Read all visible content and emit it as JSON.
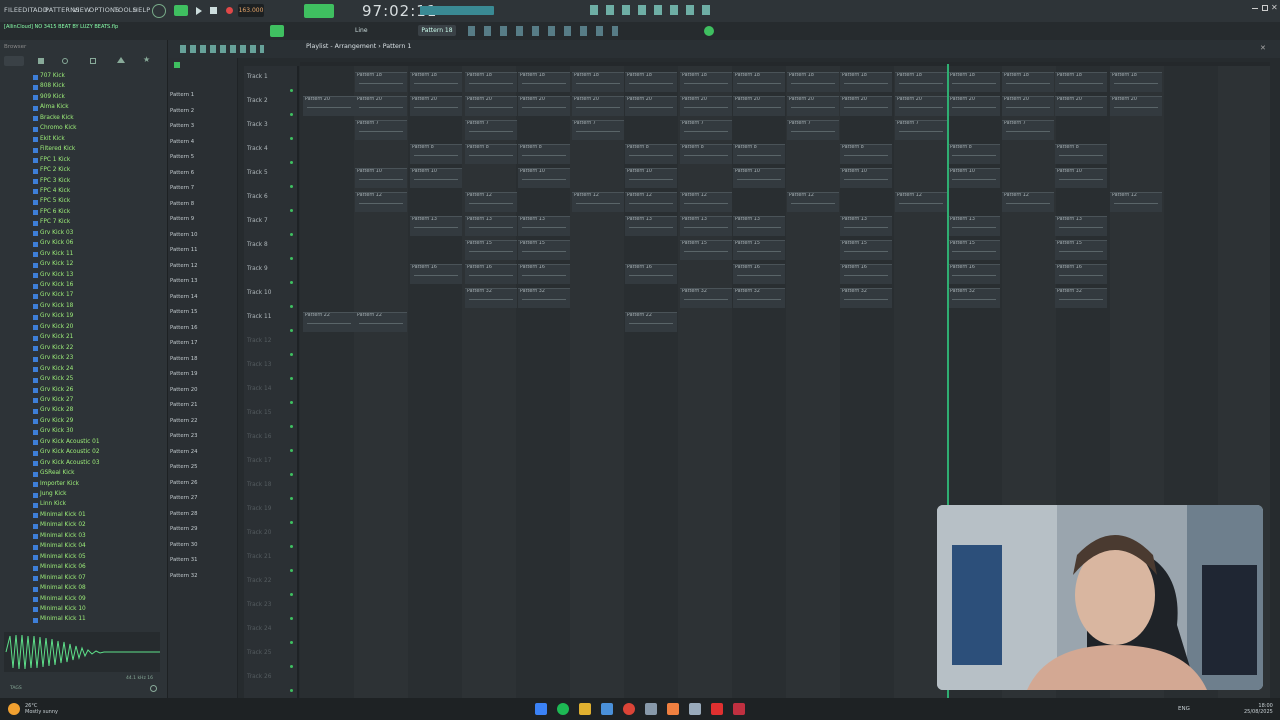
{
  "menu": {
    "items": [
      "FILE",
      "EDIT",
      "ADD",
      "PATTERNS",
      "VIEW",
      "OPTIONS",
      "TOOLS",
      "HELP"
    ]
  },
  "hint": "[AllinCloud] NO 3415 BEAT BY LUZY BEATS.flp",
  "transport": {
    "tempo": "163.000",
    "time": "97:02:11"
  },
  "pattern_selector": "Pattern 18",
  "snap": "Line",
  "playlist_title": "Playlist - Arrangement › Pattern 1",
  "browser": {
    "title": "Browser",
    "items": [
      "707 Kick",
      "808 Kick",
      "909 Kick",
      "Alma Kick",
      "Bracke Kick",
      "Chromo Kick",
      "Ekit Kick",
      "Filtered Kick",
      "FPC 1 Kick",
      "FPC 2 Kick",
      "FPC 3 Kick",
      "FPC 4 Kick",
      "FPC 5 Kick",
      "FPC 6 Kick",
      "FPC 7 Kick",
      "Grv Kick 03",
      "Grv Kick 06",
      "Grv Kick 11",
      "Grv Kick 12",
      "Grv Kick 13",
      "Grv Kick 16",
      "Grv Kick 17",
      "Grv Kick 18",
      "Grv Kick 19",
      "Grv Kick 20",
      "Grv Kick 21",
      "Grv Kick 22",
      "Grv Kick 23",
      "Grv Kick 24",
      "Grv Kick 25",
      "Grv Kick 26",
      "Grv Kick 27",
      "Grv Kick 28",
      "Grv Kick 29",
      "Grv Kick 30",
      "Grv Kick Acoustic 01",
      "Grv Kick Acoustic 02",
      "Grv Kick Acoustic 03",
      "GSReal Kick",
      "Importer Kick",
      "Jung Kick",
      "Linn Kick",
      "Minimal Kick 01",
      "Minimal Kick 02",
      "Minimal Kick 03",
      "Minimal Kick 04",
      "Minimal Kick 05",
      "Minimal Kick 06",
      "Minimal Kick 07",
      "Minimal Kick 08",
      "Minimal Kick 09",
      "Minimal Kick 10",
      "Minimal Kick 11"
    ],
    "sample_info": "44.1 kHz 16",
    "tags_label": "TAGS"
  },
  "patterns": [
    "Pattern 1",
    "Pattern 2",
    "Pattern 3",
    "Pattern 4",
    "Pattern 5",
    "Pattern 6",
    "Pattern 7",
    "Pattern 8",
    "Pattern 9",
    "Pattern 10",
    "Pattern 11",
    "Pattern 12",
    "Pattern 13",
    "Pattern 14",
    "Pattern 15",
    "Pattern 16",
    "Pattern 17",
    "Pattern 18",
    "Pattern 19",
    "Pattern 20",
    "Pattern 21",
    "Pattern 22",
    "Pattern 23",
    "Pattern 24",
    "Pattern 25",
    "Pattern 26",
    "Pattern 27",
    "Pattern 28",
    "Pattern 29",
    "Pattern 30",
    "Pattern 31",
    "Pattern 32"
  ],
  "tracks": [
    "Track 1",
    "Track 2",
    "Track 3",
    "Track 4",
    "Track 5",
    "Track 6",
    "Track 7",
    "Track 8",
    "Track 9",
    "Track 10",
    "Track 11",
    "Track 12",
    "Track 13",
    "Track 14",
    "Track 15",
    "Track 16",
    "Track 17",
    "Track 18",
    "Track 19",
    "Track 20",
    "Track 21",
    "Track 22",
    "Track 23",
    "Track 24",
    "Track 25",
    "Track 26"
  ],
  "clip_rows": [
    {
      "label": "Pattern 18",
      "starts": [
        355,
        410,
        465,
        518,
        572,
        625,
        680,
        733,
        787,
        840,
        895,
        948,
        1002,
        1055,
        1110
      ]
    },
    {
      "label": "Pattern 20",
      "starts": [
        303,
        355,
        410,
        465,
        518,
        572,
        625,
        680,
        733,
        787,
        840,
        895,
        948,
        1002,
        1055,
        1110
      ]
    },
    {
      "label": "Pattern 7",
      "starts": [
        355,
        465,
        572,
        680,
        787,
        895,
        1002
      ]
    },
    {
      "label": "Pattern 8",
      "starts": [
        410,
        465,
        518,
        625,
        680,
        733,
        840,
        948,
        1055
      ]
    },
    {
      "label": "Pattern 10",
      "starts": [
        355,
        410,
        518,
        625,
        733,
        840,
        948,
        1055
      ]
    },
    {
      "label": "Pattern 12",
      "starts": [
        355,
        465,
        572,
        625,
        680,
        787,
        895,
        1002,
        1110
      ]
    },
    {
      "label": "Pattern 13",
      "starts": [
        410,
        465,
        518,
        625,
        680,
        733,
        840,
        948,
        1055
      ]
    },
    {
      "label": "Pattern 15",
      "starts": [
        465,
        518,
        680,
        733,
        840,
        948,
        1055
      ]
    },
    {
      "label": "Pattern 16",
      "starts": [
        410,
        465,
        518,
        625,
        733,
        840,
        948,
        1055
      ]
    },
    {
      "label": "Pattern 32",
      "starts": [
        465,
        518,
        680,
        733,
        840,
        948,
        1055
      ]
    },
    {
      "label": "Pattern 22",
      "starts": [
        303,
        355,
        625
      ]
    }
  ],
  "weather": {
    "temp": "26°C",
    "desc": "Mostly sunny"
  },
  "clock": {
    "time": "18:00",
    "date": "25/08/2025"
  },
  "language": "ENG",
  "colors": {
    "accent": "#3fbf60",
    "playhead": "#2fae72",
    "browser_text": "#9ef07a"
  }
}
